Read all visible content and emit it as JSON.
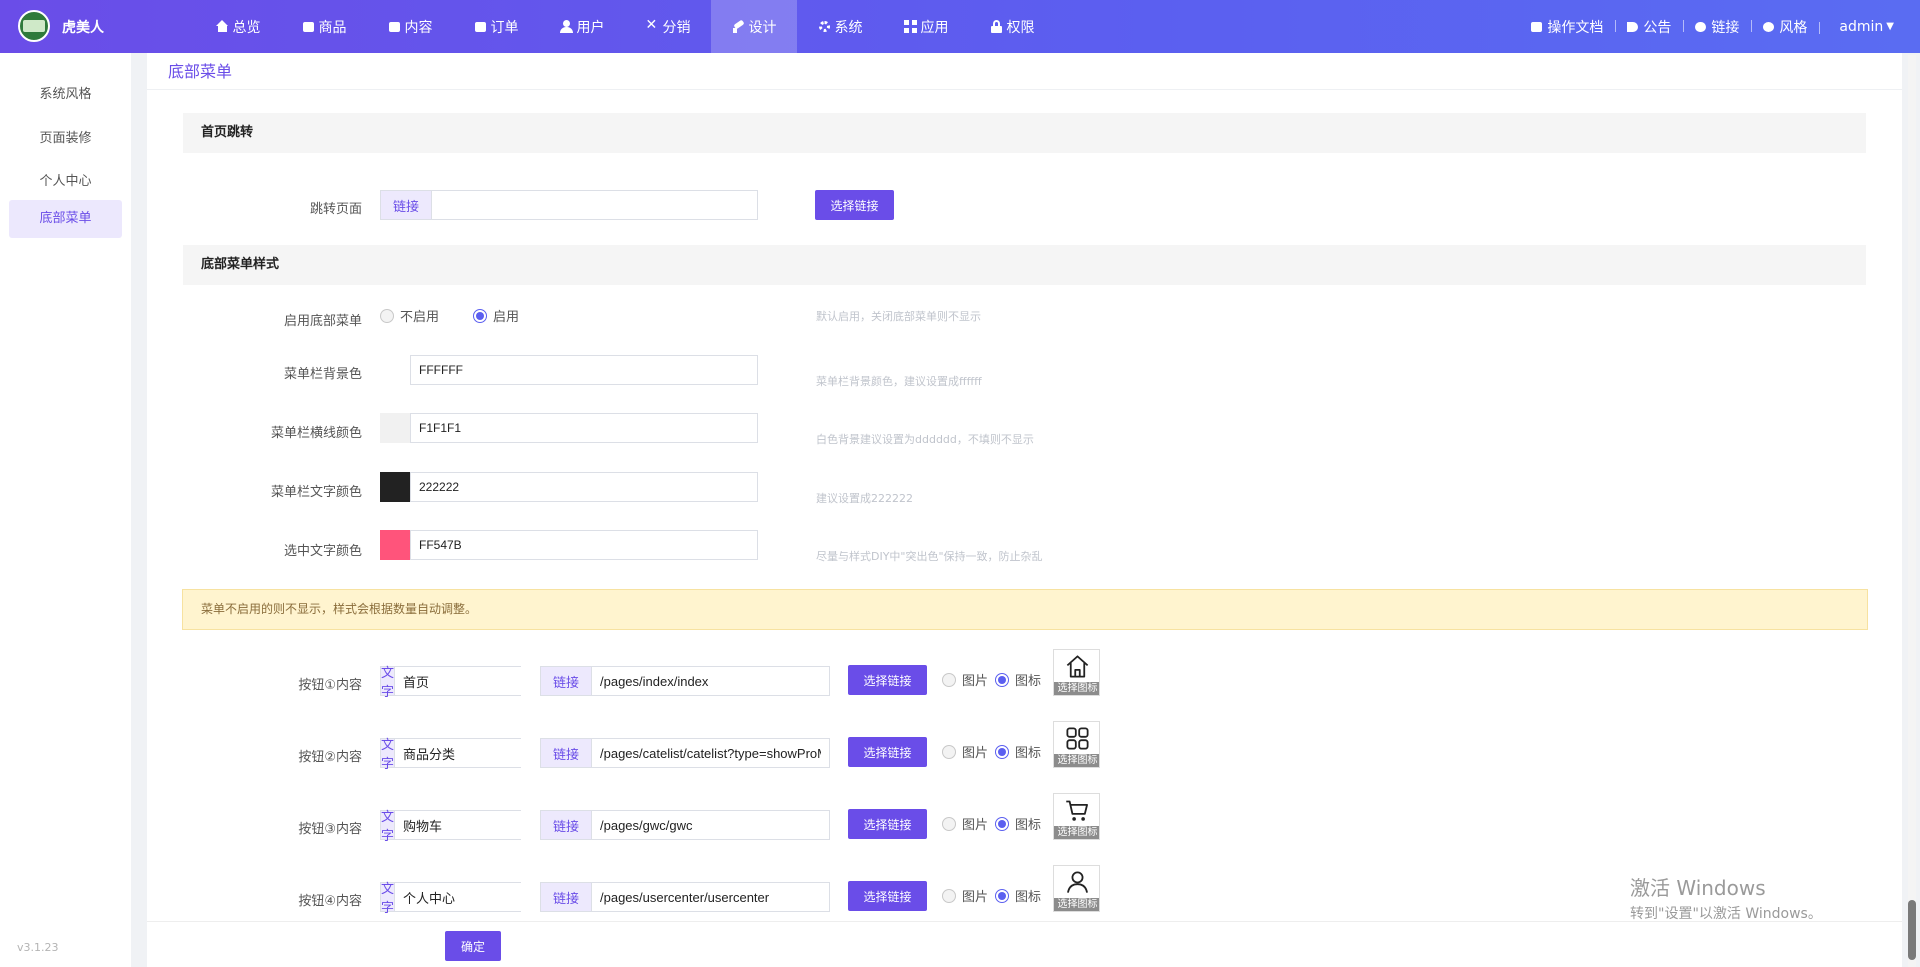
{
  "app": {
    "name": "虎美人"
  },
  "nav": [
    {
      "label": "总览",
      "icon": "home-icon"
    },
    {
      "label": "商品",
      "icon": "shopping-bag-icon"
    },
    {
      "label": "内容",
      "icon": "document-icon"
    },
    {
      "label": "订单",
      "icon": "clipboard-icon"
    },
    {
      "label": "用户",
      "icon": "user-icon"
    },
    {
      "label": "分销",
      "icon": "share-icon"
    },
    {
      "label": "设计",
      "icon": "brush-icon",
      "active": true
    },
    {
      "label": "系统",
      "icon": "gear-icon"
    },
    {
      "label": "应用",
      "icon": "grid-icon"
    },
    {
      "label": "权限",
      "icon": "lock-icon"
    }
  ],
  "header_links": {
    "docs": "操作文档",
    "notice": "公告",
    "link": "链接",
    "style": "风格",
    "admin": "admin"
  },
  "sidebar": {
    "items": [
      {
        "label": "系统风格"
      },
      {
        "label": "页面装修"
      },
      {
        "label": "个人中心"
      },
      {
        "label": "底部菜单",
        "active": true
      }
    ],
    "version": "v3.1.23"
  },
  "page": {
    "title": "底部菜单"
  },
  "home_jump": {
    "heading": "首页跳转",
    "label": "跳转页面",
    "addon": "链接",
    "value": "",
    "button": "选择链接"
  },
  "style_section": {
    "heading": "底部菜单样式",
    "enable": {
      "label": "启用底部菜单",
      "options": [
        "不启用",
        "启用"
      ],
      "selected": "启用",
      "hint": "默认启用，关闭底部菜单则不显示"
    },
    "bg_color": {
      "label": "菜单栏背景色",
      "value": "FFFFFF",
      "swatch": "#FFFFFF",
      "hint": "菜单栏背景颜色，建议设置成ffffff"
    },
    "line_color": {
      "label": "菜单栏横线颜色",
      "value": "F1F1F1",
      "swatch": "#F1F1F1",
      "hint": "白色背景建议设置为dddddd，不填则不显示"
    },
    "text_color": {
      "label": "菜单栏文字颜色",
      "value": "222222",
      "swatch": "#222222",
      "hint": "建议设置成222222"
    },
    "active_color": {
      "label": "选中文字颜色",
      "value": "FF547B",
      "swatch": "#FF547B",
      "hint": "尽量与样式DIY中\"突出色\"保持一致，防止杂乱"
    }
  },
  "alert": "菜单不启用的则不显示，样式会根据数量自动调整。",
  "buttons_common": {
    "text_addon": "文字",
    "link_addon": "链接",
    "select_link": "选择链接",
    "opt_image": "图片",
    "opt_icon": "图标",
    "icon_caption": "选择图标"
  },
  "menu_buttons": [
    {
      "label": "按钮①内容",
      "text": "首页",
      "link": "/pages/index/index",
      "mode": "图标",
      "icon": "home-outline-icon"
    },
    {
      "label": "按钮②内容",
      "text": "商品分类",
      "link": "/pages/catelist/catelist?type=showProM",
      "mode": "图标",
      "icon": "category-grid-icon"
    },
    {
      "label": "按钮③内容",
      "text": "购物车",
      "link": "/pages/gwc/gwc",
      "mode": "图标",
      "icon": "cart-icon"
    },
    {
      "label": "按钮④内容",
      "text": "个人中心",
      "link": "/pages/usercenter/usercenter",
      "mode": "图标",
      "icon": "person-outline-icon"
    }
  ],
  "submit": "确定",
  "watermark": {
    "line1": "激活 Windows",
    "line2": "转到\"设置\"以激活 Windows。"
  },
  "colors": {
    "accent": "#6a4de8",
    "nav_gradient_start": "#6a4de8",
    "nav_gradient_end": "#5a6cf2"
  }
}
